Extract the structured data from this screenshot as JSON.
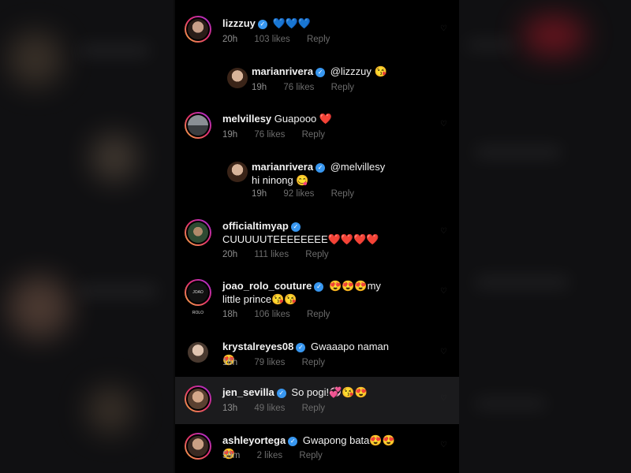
{
  "comments": [
    {
      "user": "lizzzuy",
      "text": "💙💙💙",
      "time": "20h",
      "likes": "103 likes",
      "reply": "Reply"
    },
    {
      "user": "marianrivera",
      "text": "@lizzzuy 😘",
      "time": "19h",
      "likes": "76 likes",
      "reply": "Reply"
    },
    {
      "user": "melvillesy",
      "text": "Guapooo ❤️",
      "time": "19h",
      "likes": "76 likes",
      "reply": "Reply"
    },
    {
      "user": "marianrivera",
      "text": "@melvillesy hi ninong 😋",
      "time": "19h",
      "likes": "92 likes",
      "reply": "Reply"
    },
    {
      "user": "officialtimyap",
      "text": "CUUUUUTEEEEEEEE❤️❤️❤️❤️",
      "time": "20h",
      "likes": "111 likes",
      "reply": "Reply"
    },
    {
      "user": "joao_rolo_couture",
      "text": "😍😍😍my little prince😘😘",
      "time": "18h",
      "likes": "106 likes",
      "reply": "Reply"
    },
    {
      "user": "krystalreyes08",
      "text": "Gwaaapo naman 😍",
      "time": "16h",
      "likes": "79 likes",
      "reply": "Reply"
    },
    {
      "user": "jen_sevilla",
      "text": "So pogi!💞😘😍",
      "time": "13h",
      "likes": "49 likes",
      "reply": "Reply"
    },
    {
      "user": "ashleyortega",
      "text": "Gwapong bata😍😍😍",
      "time": "59m",
      "likes": "2 likes",
      "reply": "Reply"
    }
  ],
  "logo_text": "JOAO ROLO",
  "colors": {
    "verified": "#3897f0",
    "highlight": "#1b1b1d",
    "muted": "#8e8e8e"
  }
}
